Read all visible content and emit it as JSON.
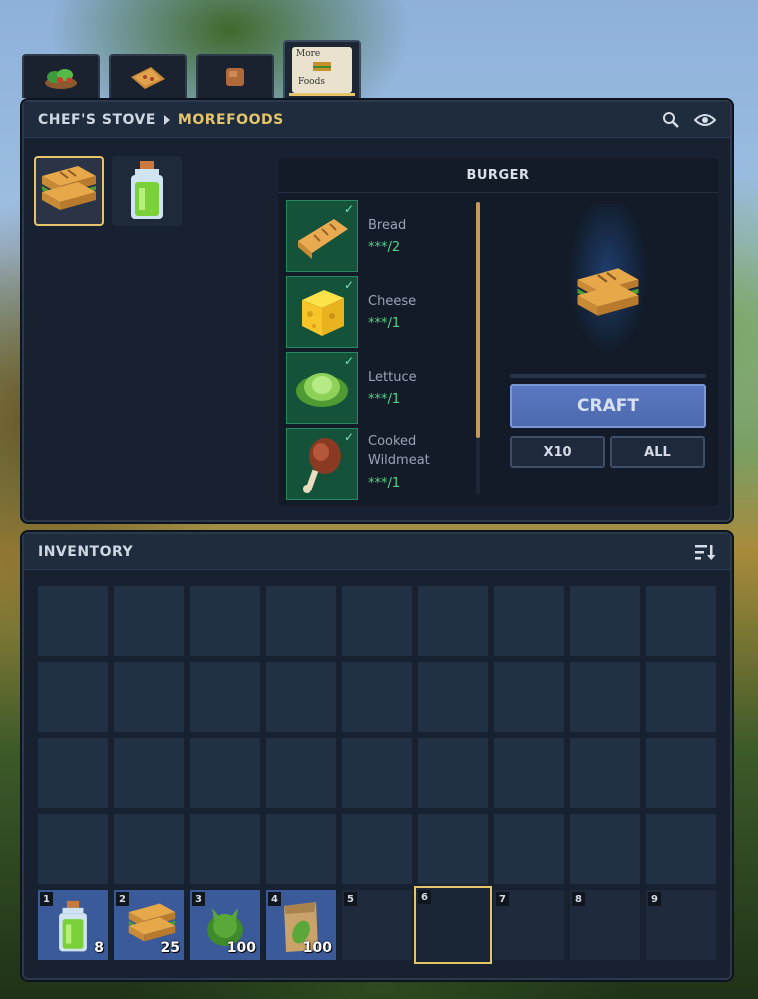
{
  "tabs": [
    {
      "name": "salad-tab",
      "icon": "salad-icon"
    },
    {
      "name": "pizza-tab",
      "icon": "pizza-icon"
    },
    {
      "name": "meat-tab",
      "icon": "meat-cube-icon"
    },
    {
      "name": "morefoods-tab",
      "icon": "morefoods-doodle-icon",
      "doodle_lines": [
        "More",
        "Foods"
      ],
      "active": true
    }
  ],
  "crafting": {
    "breadcrumb_root": "CHEF'S STOVE",
    "breadcrumb_current": "MOREFOODS",
    "recipes": [
      {
        "name": "Burger",
        "icon": "burger-icon",
        "selected": true
      },
      {
        "name": "Lettuce Jar",
        "icon": "lettuce-jar-icon",
        "selected": false
      }
    ],
    "detail": {
      "title": "BURGER",
      "ingredients": [
        {
          "name": "Bread",
          "qty": "***/2",
          "icon": "bread-icon"
        },
        {
          "name": "Cheese",
          "qty": "***/1",
          "icon": "cheese-icon"
        },
        {
          "name": "Lettuce",
          "qty": "***/1",
          "icon": "lettuce-icon"
        },
        {
          "name_line1": "Cooked",
          "name_line2": "Wildmeat",
          "qty": "***/1",
          "icon": "cooked-wildmeat-icon"
        }
      ],
      "craft_label": "CRAFT",
      "x10_label": "X10",
      "all_label": "ALL"
    }
  },
  "inventory": {
    "title": "INVENTORY",
    "rows": 4,
    "cols": 9,
    "hotbar": [
      {
        "slot": "1",
        "count": "8",
        "icon": "lettuce-jar-icon"
      },
      {
        "slot": "2",
        "count": "25",
        "icon": "burger-icon"
      },
      {
        "slot": "3",
        "count": "100",
        "icon": "lettuce-leaf-icon"
      },
      {
        "slot": "4",
        "count": "100",
        "icon": "seed-bag-icon"
      },
      {
        "slot": "5",
        "count": "",
        "icon": ""
      },
      {
        "slot": "6",
        "count": "",
        "icon": "",
        "selected": true
      },
      {
        "slot": "7",
        "count": "",
        "icon": ""
      },
      {
        "slot": "8",
        "count": "",
        "icon": ""
      },
      {
        "slot": "9",
        "count": "",
        "icon": ""
      }
    ]
  },
  "colors": {
    "accent": "#e6c46a",
    "craft_button": "#5a78c2",
    "ingredient_ok": "#54d18a",
    "panel_bg": "#172130"
  }
}
